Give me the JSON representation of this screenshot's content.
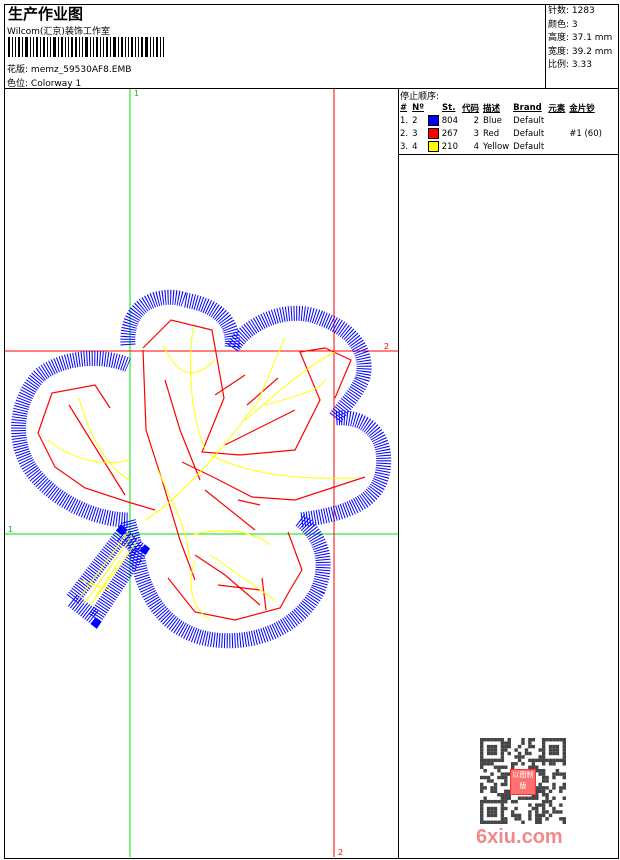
{
  "header": {
    "title": "生产作业图",
    "company": "Wilcom(汇京)装饰工作室",
    "design_label": "花版:",
    "design_value": "memz_59530AF8.EMB",
    "colorway_label": "色位:",
    "colorway_value": "Colorway 1"
  },
  "info": {
    "stitches": "针数: 1283",
    "colors": "颜色: 3",
    "height": "高度: 37.1 mm",
    "width": "宽度: 39.2 mm",
    "scale": "比例: 3.33"
  },
  "sequence": {
    "title": "停止顺序:",
    "columns": [
      "#",
      "Nº",
      "St.",
      "代码",
      "描述",
      "Brand",
      "元素",
      "金片钞"
    ],
    "rows": [
      {
        "idx": "1.",
        "n": "2",
        "color": "#0000ff",
        "st": "804",
        "code": "2",
        "desc": "Blue",
        "brand": "Default",
        "element": "",
        "sequin": ""
      },
      {
        "idx": "2.",
        "n": "3",
        "color": "#ff0000",
        "st": "267",
        "code": "3",
        "desc": "Red",
        "brand": "Default",
        "element": "",
        "sequin": "#1 (60)"
      },
      {
        "idx": "3.",
        "n": "4",
        "color": "#ffff00",
        "st": "210",
        "code": "4",
        "desc": "Yellow",
        "brand": "Default",
        "element": "",
        "sequin": ""
      }
    ]
  },
  "guides": {
    "green_v": "1",
    "green_h": "1",
    "red_h": "2",
    "red_v": "2"
  },
  "watermark": {
    "text": "6xiu.com",
    "stamp": "以图制版"
  }
}
